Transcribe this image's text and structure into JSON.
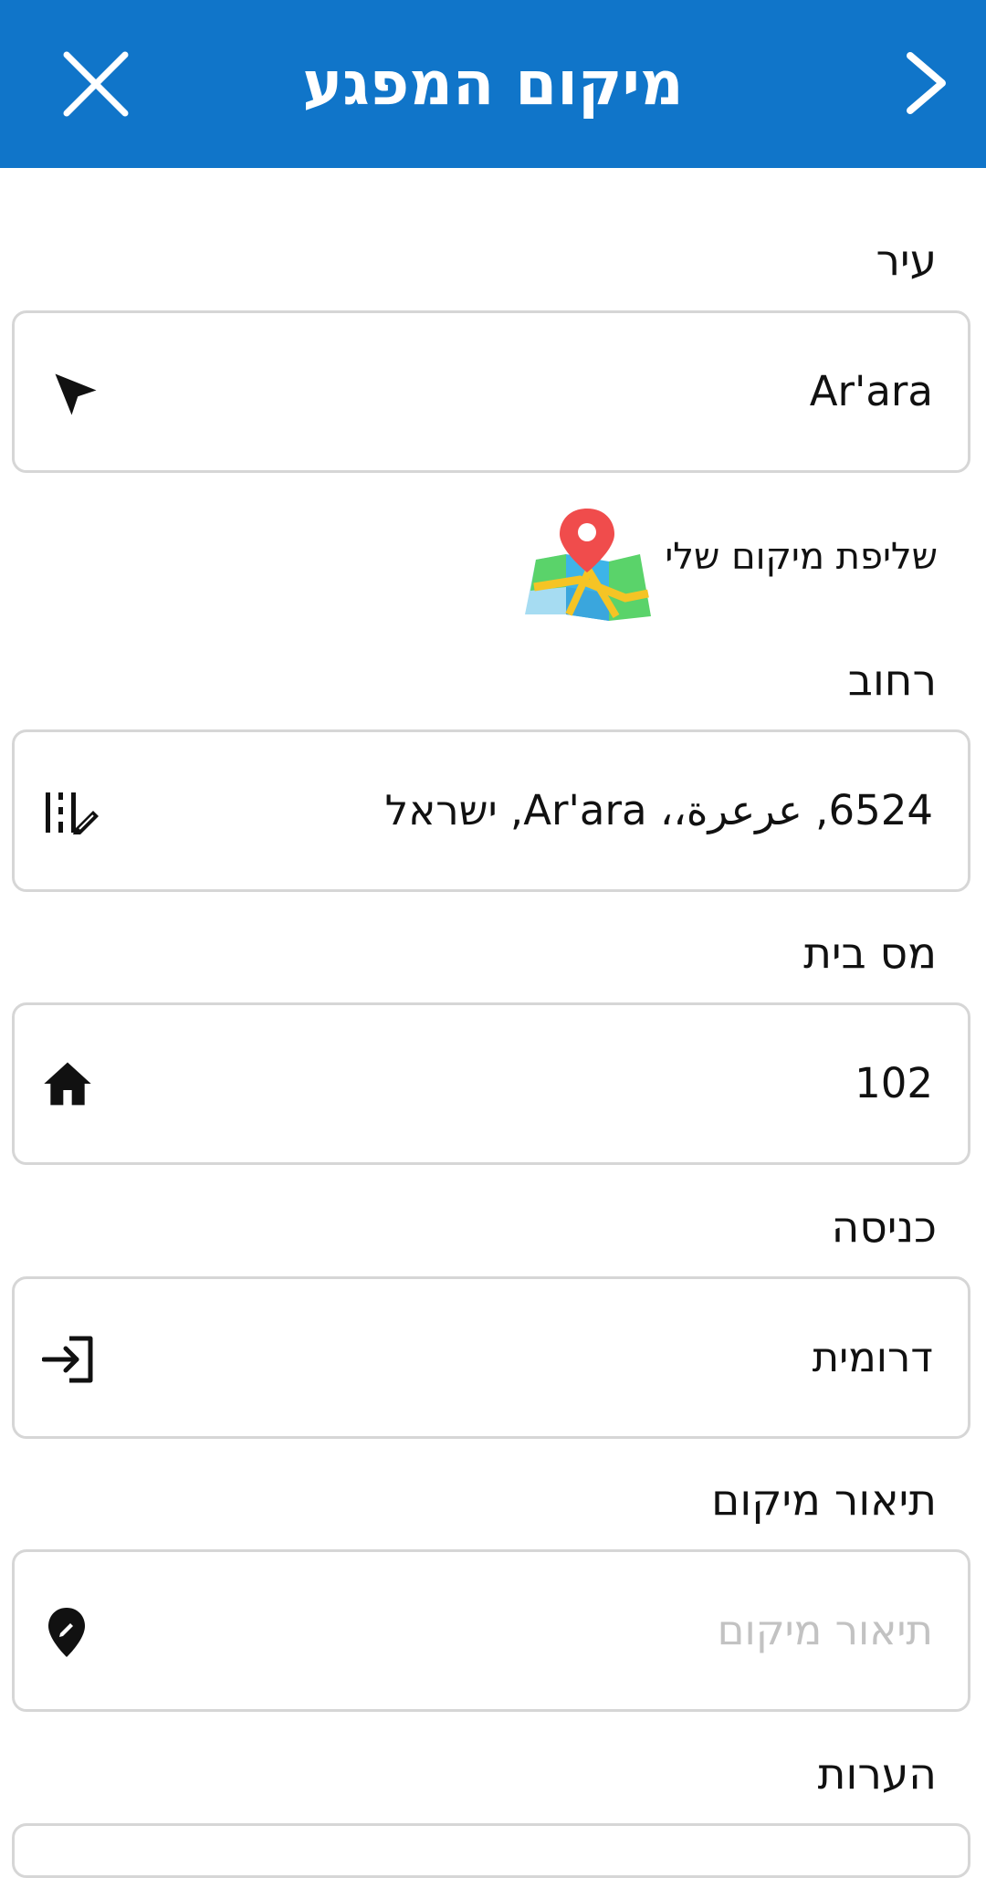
{
  "header": {
    "title": "מיקום המפגע",
    "background": "#1075c9"
  },
  "city": {
    "label": "עיר",
    "value": "Ar'ara",
    "icon": "navigation-arrow-icon"
  },
  "my_location": {
    "label": "שליפת מיקום שלי",
    "icon": "map-pin-icon"
  },
  "street": {
    "label": "רחוב",
    "value": "6524, عرعرة،، Ar'ara, ישראל",
    "icon": "street-edit-icon"
  },
  "house_number": {
    "label": "מס בית",
    "value": "102",
    "icon": "home-icon"
  },
  "entrance": {
    "label": "כניסה",
    "value": "דרומית",
    "icon": "login-icon"
  },
  "location_description": {
    "label": "תיאור מיקום",
    "placeholder": "תיאור מיקום",
    "icon": "location-edit-icon"
  },
  "notes": {
    "label": "הערות"
  }
}
